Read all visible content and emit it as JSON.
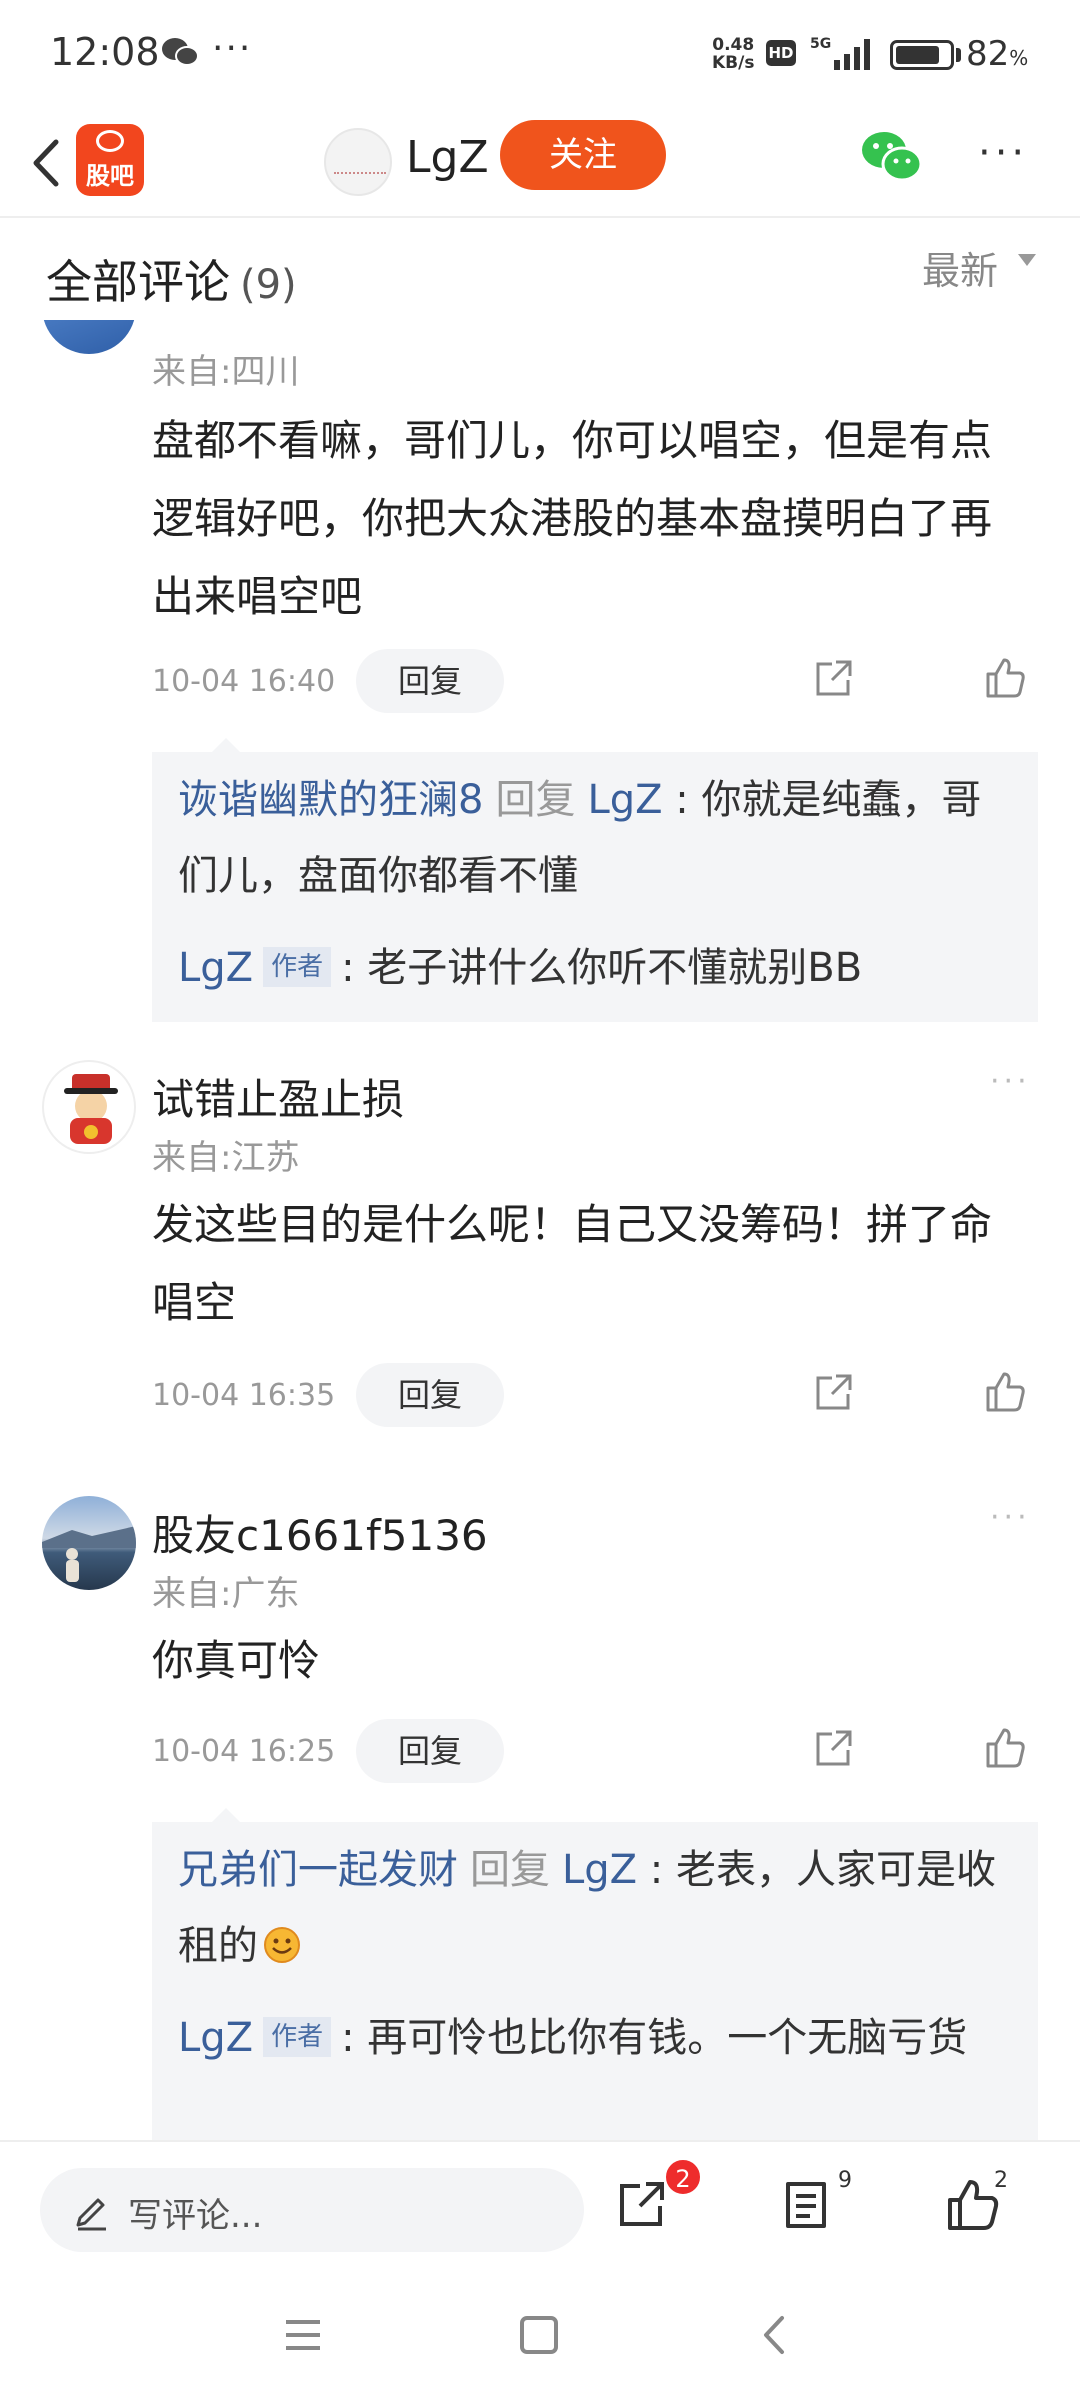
{
  "status_bar": {
    "time": "12:08",
    "speed_value": "0.48",
    "speed_unit": "KB/s",
    "hd": "HD",
    "network": "5G",
    "battery_percent": "82",
    "battery_level": 0.82
  },
  "header": {
    "app_logo_text": "股吧",
    "user_name": "LgZ",
    "follow_label": "关注"
  },
  "section": {
    "title": "全部评论",
    "count": "(9)",
    "sort_label": "最新"
  },
  "comments": [
    {
      "from": "来自:四川",
      "text": "盘都不看嘛，哥们儿，你可以唱空，但是有点逻辑好吧，你把大众港股的基本盘摸明白了再出来唱空吧",
      "time": "10-04 16:40",
      "reply_label": "回复",
      "replies": [
        {
          "name": "诙谐幽默的狂澜8",
          "verb": "回复",
          "target": "LgZ",
          "text": "你就是纯蠢，哥们儿，盘面你都看不懂"
        },
        {
          "name": "LgZ",
          "tag": "作者",
          "text": "老子讲什么你听不懂就别BB"
        }
      ]
    },
    {
      "user": "试错止盈止损",
      "from": "来自:江苏",
      "text": "发这些目的是什么呢！自己又没筹码！拼了命唱空",
      "time": "10-04 16:35",
      "reply_label": "回复"
    },
    {
      "user": "股友c1661f5136",
      "from": "来自:广东",
      "text": "你真可怜",
      "time": "10-04 16:25",
      "reply_label": "回复",
      "replies": [
        {
          "name": "兄弟们一起发财",
          "verb": "回复",
          "target": "LgZ",
          "text": "老表，人家可是收租的"
        },
        {
          "name": "LgZ",
          "tag": "作者",
          "text": "再可怜也比你有钱。一个无脑亏货"
        }
      ]
    }
  ],
  "bottom_bar": {
    "write_placeholder": "写评论...",
    "share_badge": "2",
    "comment_count": "9",
    "like_count": "2"
  },
  "icons": {
    "back": "back-arrow-icon",
    "share": "share-icon",
    "like": "thumbs-up-icon",
    "wechat": "wechat-icon"
  },
  "colors": {
    "accent": "#f0541c",
    "link_blue": "#3a5f9a",
    "badge_red": "#ee2c2c"
  }
}
